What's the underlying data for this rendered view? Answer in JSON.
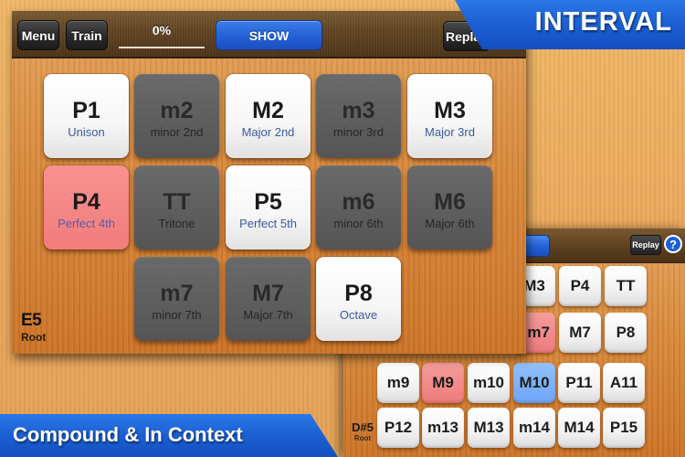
{
  "main_screen": {
    "toolbar": {
      "menu_label": "Menu",
      "train_label": "Train",
      "progress": "0%",
      "show_label": "SHOW",
      "replay_label": "Replay"
    },
    "keys": [
      {
        "abbr": "P1",
        "name": "Unison",
        "state": "white"
      },
      {
        "abbr": "m2",
        "name": "minor 2nd",
        "state": "dark"
      },
      {
        "abbr": "M2",
        "name": "Major 2nd",
        "state": "white"
      },
      {
        "abbr": "m3",
        "name": "minor 3rd",
        "state": "dark"
      },
      {
        "abbr": "M3",
        "name": "Major 3rd",
        "state": "white"
      },
      {
        "abbr": "P4",
        "name": "Perfect 4th",
        "state": "red"
      },
      {
        "abbr": "TT",
        "name": "Tritone",
        "state": "dark"
      },
      {
        "abbr": "P5",
        "name": "Perfect 5th",
        "state": "white"
      },
      {
        "abbr": "m6",
        "name": "minor 6th",
        "state": "dark"
      },
      {
        "abbr": "M6",
        "name": "Major 6th",
        "state": "dark"
      },
      {
        "abbr": "m7",
        "name": "minor 7th",
        "state": "dark"
      },
      {
        "abbr": "M7",
        "name": "Major 7th",
        "state": "dark"
      },
      {
        "abbr": "P8",
        "name": "Octave",
        "state": "white"
      }
    ],
    "root": {
      "note": "E5",
      "label": "Root"
    }
  },
  "back_screen": {
    "replay_label": "Replay",
    "help_label": "?",
    "keys_partial": [
      {
        "abbr": "M3",
        "state": "white"
      },
      {
        "abbr": "P4",
        "state": "white"
      },
      {
        "abbr": "TT",
        "state": "white"
      },
      {
        "abbr": "m7",
        "state": "red"
      },
      {
        "abbr": "M7",
        "state": "white"
      },
      {
        "abbr": "P8",
        "state": "white"
      }
    ],
    "compound_keys": [
      {
        "abbr": "m9",
        "state": "white"
      },
      {
        "abbr": "M9",
        "state": "red"
      },
      {
        "abbr": "m10",
        "state": "white"
      },
      {
        "abbr": "M10",
        "state": "blue"
      },
      {
        "abbr": "P11",
        "state": "white"
      },
      {
        "abbr": "A11",
        "state": "white"
      },
      {
        "abbr": "P12",
        "state": "white"
      },
      {
        "abbr": "m13",
        "state": "white"
      },
      {
        "abbr": "M13",
        "state": "white"
      },
      {
        "abbr": "m14",
        "state": "white"
      },
      {
        "abbr": "M14",
        "state": "white"
      },
      {
        "abbr": "P15",
        "state": "white"
      }
    ],
    "root": {
      "note": "D#5",
      "label": "Root"
    }
  },
  "banners": {
    "top": "INTERVAL",
    "bottom": "Compound & In Context"
  },
  "colors": {
    "accent_blue": "#2563d8",
    "wrong_red": "#f27c7c",
    "correct_blue": "#6ea5f7",
    "key_dark": "#5f5f5f",
    "key_white": "#f6f6f6"
  }
}
